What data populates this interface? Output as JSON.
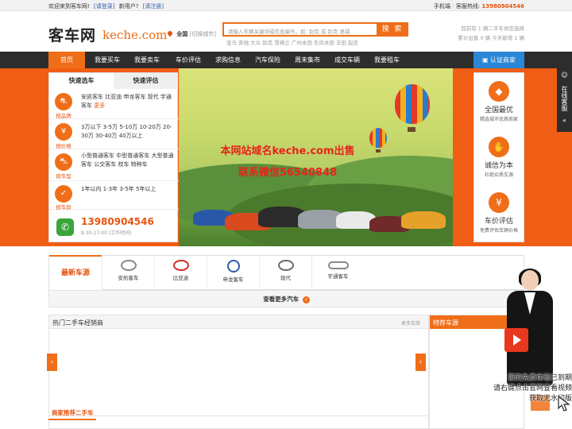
{
  "topbar": {
    "welcome": "欢迎来到客车网!",
    "login": "[请登录]",
    "new_user": "新用户?",
    "register": "[请注册]",
    "mobile": "手机端",
    "hotline_label": "客服热线:",
    "hotline": "13980904546"
  },
  "header": {
    "logo_cn": "客车网",
    "logo_en": "keche.com",
    "city": "全国",
    "city_switch": "[切换城市]",
    "search_placeholder": "请输入车辆关键词或信息编号。如: 别克 或 别克 君威",
    "search_button": "搜 索",
    "hotwords": "宝马  奔驰  大众  别克  雪佛兰  广州本田  东风本田  丰田  起亚",
    "stats_line1": "目前有 1 辆二手车供您选择",
    "stats_line2": "累计出售 0 辆  今天新增 1 辆"
  },
  "nav": {
    "items": [
      "首页",
      "我要买车",
      "我要卖车",
      "车价评估",
      "求购信息",
      "汽车保险",
      "周末集市",
      "成交车辆",
      "我要租车"
    ],
    "certify": "认证商家"
  },
  "quick": {
    "tab1": "快速选车",
    "tab2": "快速评估",
    "rows": [
      {
        "label": "按品牌",
        "text": "安凯客车  比亚迪  申龙客车  现代  宇通客车",
        "more": "更多"
      },
      {
        "label": "按价格",
        "text": "3万以下  3-5万  5-10万  10-20万  20-30万  30-40万  40万以上"
      },
      {
        "label": "按车型",
        "text": "小型普通客车  中型普通客车  大型普通客车  公交客车  校车  特种车"
      },
      {
        "label": "按车龄",
        "text": "1年以内  1-3年  3-5年  5年以上"
      }
    ],
    "phone": "13980904546",
    "phone_time": "8:30-17:00 (工作时间)"
  },
  "banner": {
    "line1": "本网站域名keche.com出售",
    "line2": "联系微信56540848"
  },
  "features": [
    {
      "title": "全国最优",
      "sub": "精选城市优质商家",
      "icon": "map-icon"
    },
    {
      "title": "诚信为本",
      "sub": "杜绝劣质车源",
      "icon": "handshake-icon"
    },
    {
      "title": "车价评估",
      "sub": "免费评估车辆价格",
      "icon": "yen-icon"
    }
  ],
  "service": {
    "label": "在线客服"
  },
  "brands": {
    "title": "最新车源",
    "items": [
      "安凯客车",
      "比亚迪",
      "申龙客车",
      "现代",
      "宇通客车"
    ],
    "more": "查看更多汽车"
  },
  "dealers": {
    "title": "热门二手车经销商",
    "more": "更多车商"
  },
  "recommend": {
    "title": "商家推荐二手车"
  },
  "special": {
    "title": "特荐车源"
  },
  "video": {
    "line1": "您的免费体验已到期",
    "line2": "请右键点击官网查看视频",
    "line3": "获取无水印版"
  },
  "colors": {
    "accent": "#f06e19",
    "nav": "#2d2d2d",
    "certify": "#2b86d6"
  }
}
